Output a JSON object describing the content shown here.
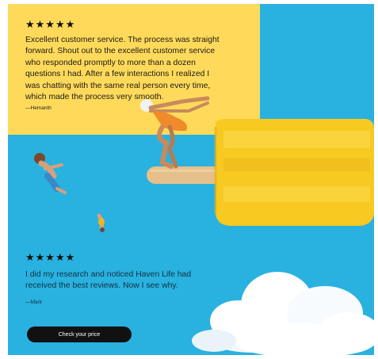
{
  "testimonials": [
    {
      "stars": "★★★★★",
      "text": "Excellent customer service. The process was straight forward. Shout out to the excellent customer service who responded promptly to more than a dozen questions I had. After a few interactions I realized I was chatting with the same real person every time, which made the process very smooth.",
      "author": "—Hemanth"
    },
    {
      "stars": "★★★★★",
      "text": "I did my research and noticed Haven Life had received the best reviews. Now I see why.",
      "author": "—Mark"
    }
  ],
  "cta": {
    "label": "Check your price"
  },
  "colors": {
    "sky": "#29b1e0",
    "panel": "#ffda5a",
    "popsicle": "#f7c921",
    "stick": "#e6c08a",
    "button": "#111111"
  },
  "icons": [
    "star-icon",
    "popsicle-illustration",
    "diver-figure",
    "child-figure",
    "cloud-illustration"
  ]
}
